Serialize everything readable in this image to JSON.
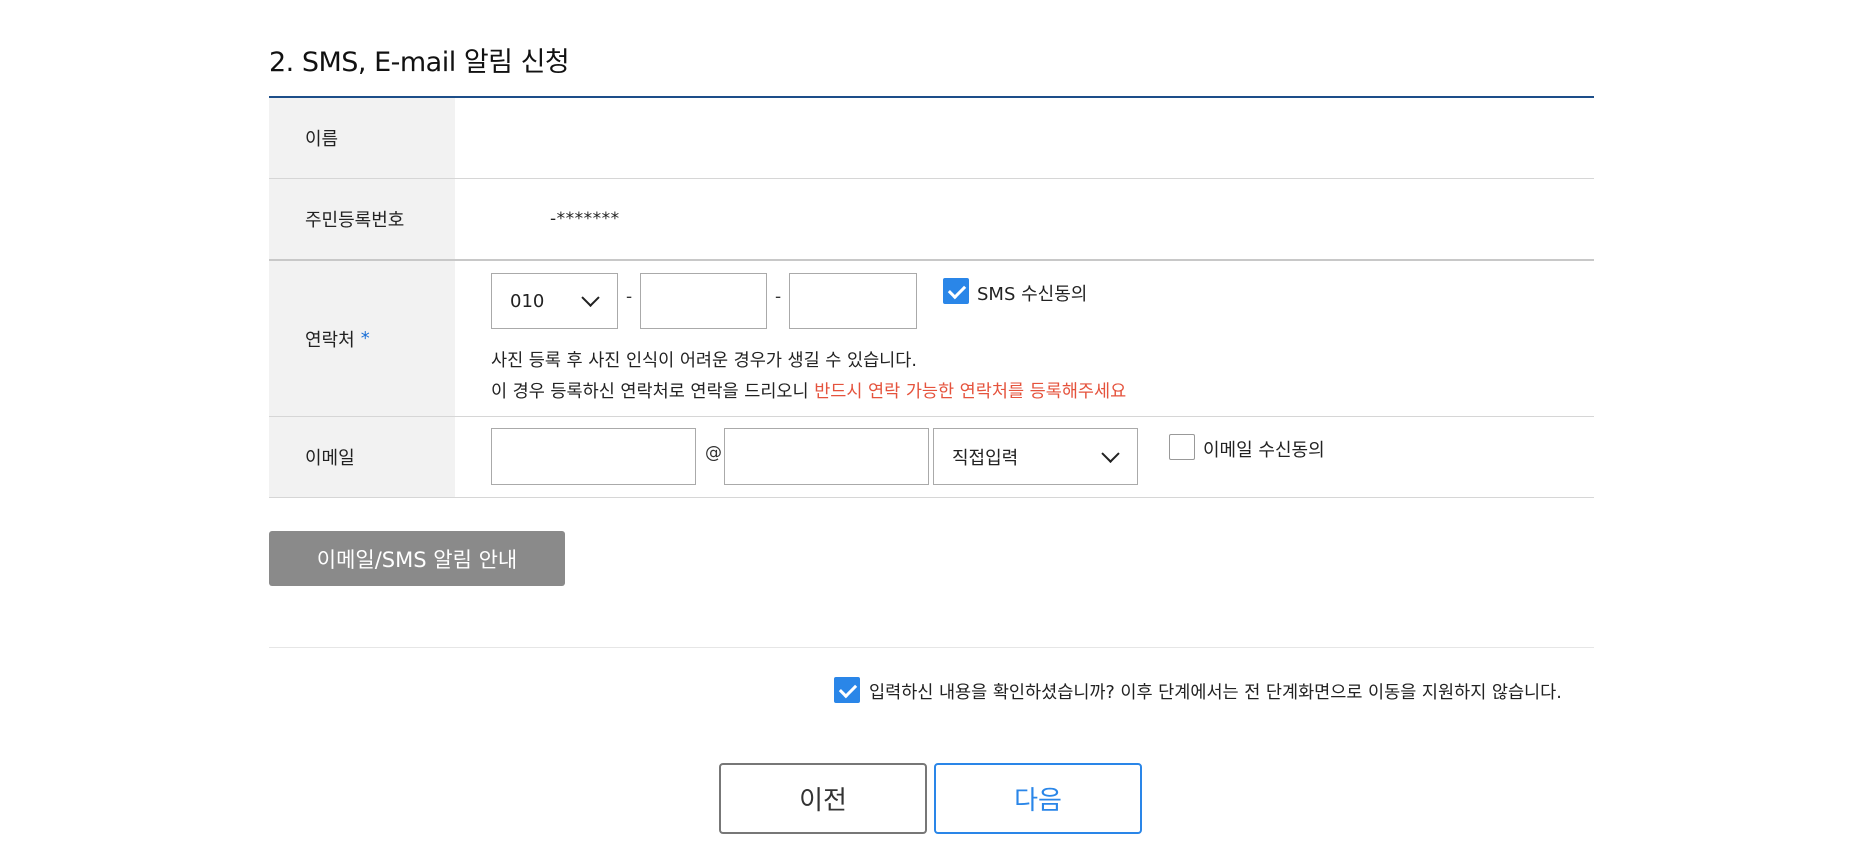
{
  "section": {
    "title": "2. SMS, E-mail 알림 신청"
  },
  "form": {
    "name": {
      "label": "이름",
      "value": ""
    },
    "ssn": {
      "label": "주민등록번호",
      "masked": "-*******"
    },
    "phone": {
      "label": "연락처",
      "required_mark": "*",
      "prefix_selected": "010",
      "separator": "-",
      "middle": "",
      "last": "",
      "sms_consent_label": "SMS 수신동의",
      "sms_consent_checked": true,
      "notice_line1": "사진 등록 후 사진 인식이 어려운 경우가 생길 수 있습니다.",
      "notice_line2_prefix": "이 경우 등록하신 연락처로 연락을 드리오니 ",
      "notice_line2_highlight": "반드시 연락 가능한 연락처를 등록해주세요"
    },
    "email": {
      "label": "이메일",
      "local": "",
      "at": "@",
      "domain": "",
      "domain_select": "직접입력",
      "consent_label": "이메일 수신동의",
      "consent_checked": false
    }
  },
  "guide_button": "이메일/SMS 알림 안내",
  "confirm": {
    "label": "입력하신 내용을 확인하셨습니까? 이후 단계에서는 전 단계화면으로 이동을 지원하지 않습니다.",
    "checked": true
  },
  "nav": {
    "prev": "이전",
    "next": "다음"
  },
  "colors": {
    "accent": "#2a86e8",
    "header_line": "#1d4e89",
    "highlight": "#e5533d",
    "guide_button": "#8a8a8a"
  }
}
